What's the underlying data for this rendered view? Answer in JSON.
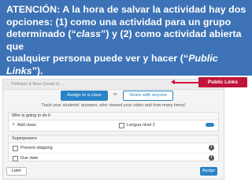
{
  "banner": {
    "line1": "ATENCIÓN: A la hora de salvar la actividad hay dos",
    "line2": "opciones: (1) como una actividad para un grupo",
    "line3_a": "determinado (“",
    "line3_em": "class",
    "line3_b": "”) y (2) como actividad abierta que",
    "line4_a": "cualquier persona puede ver  y hacer (“",
    "line4_em": "Public Links",
    "line4_b": "”)."
  },
  "screenshot": {
    "topbar_text": "← Pollinator & Bees (Grade 5) ...",
    "assign_class_label": "Assign to a class",
    "or_label": "or",
    "share_label": "Share with anyone",
    "track_text": "Track your students' answers, who viewed your video and how many times!",
    "who_heading": "Who is going to do it",
    "add_class_label": "Add class",
    "class_name": "Lengua nivel 2",
    "superpowers_heading": "Superpowers",
    "prevent_skipping_label": "Prevent skipping",
    "due_date_label": "Due date",
    "later_label": "Later",
    "assign_label": "Assign"
  },
  "callout": {
    "label": "Public Links",
    "color": "#c0143c"
  },
  "colors": {
    "banner_bg": "#3d72b6",
    "accent": "#2a84c6"
  }
}
